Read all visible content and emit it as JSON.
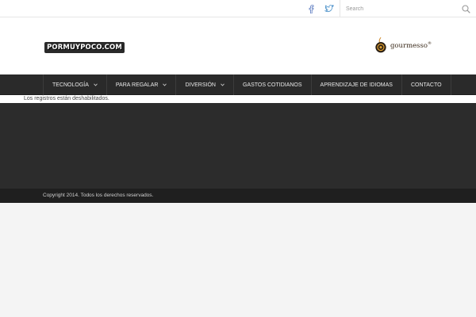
{
  "topbar": {
    "social": [
      {
        "icon": "facebook-icon",
        "color": "#3b5998"
      },
      {
        "icon": "twitter-icon",
        "color": "#1da1f2"
      }
    ],
    "search": {
      "placeholder": "Search",
      "value": ""
    }
  },
  "header": {
    "logo_text": "PORMUYPOCO.COM",
    "ad": {
      "brand": "gourmesso",
      "trademark": "®"
    }
  },
  "nav": {
    "items": [
      {
        "label": "TECNOLOGÍA",
        "has_dropdown": true
      },
      {
        "label": "PARA REGALAR",
        "has_dropdown": true
      },
      {
        "label": "DIVERSIÓN",
        "has_dropdown": true
      },
      {
        "label": "GASTOS COTIDIANOS",
        "has_dropdown": false
      },
      {
        "label": "APRENDIZAJE DE IDIOMAS",
        "has_dropdown": false
      },
      {
        "label": "CONTACTO",
        "has_dropdown": false
      }
    ]
  },
  "content": {
    "notice": "Los registros están deshabilitados."
  },
  "footer": {
    "copyright": "Copyright 2014. Todos los derechos reservados."
  },
  "colors": {
    "nav_bg": "#2a2a2a",
    "dark_area": "#2c2c2c",
    "footer_bg": "#1f1f1f",
    "page_bg": "#f4f4f4"
  }
}
